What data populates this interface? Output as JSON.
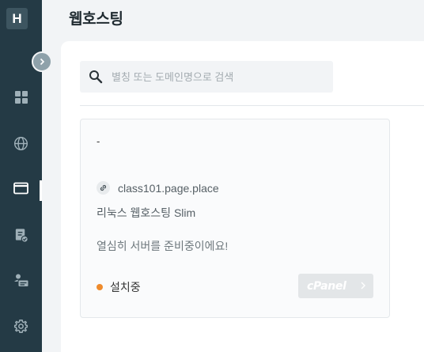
{
  "sidebar": {
    "logo": "H",
    "items": [
      {
        "name": "dashboard",
        "icon": "grid-icon"
      },
      {
        "name": "domain",
        "icon": "globe-icon"
      },
      {
        "name": "hosting",
        "icon": "window-icon",
        "active": true
      },
      {
        "name": "billing",
        "icon": "invoice-check-icon"
      },
      {
        "name": "account",
        "icon": "id-card-icon"
      },
      {
        "name": "settings",
        "icon": "gear-icon"
      }
    ]
  },
  "page": {
    "title": "웹호스팅"
  },
  "search": {
    "placeholder": "별칭 또는 도메인명으로 검색",
    "value": ""
  },
  "hosting_card": {
    "alias": "-",
    "domain": "class101.page.place",
    "plan": "리눅스 웹호스팅 Slim",
    "notice": "열심히 서버를 준비중이에요!",
    "status": "설치중",
    "status_color": "#ef8b2c",
    "cpanel_label": "cPanel"
  }
}
